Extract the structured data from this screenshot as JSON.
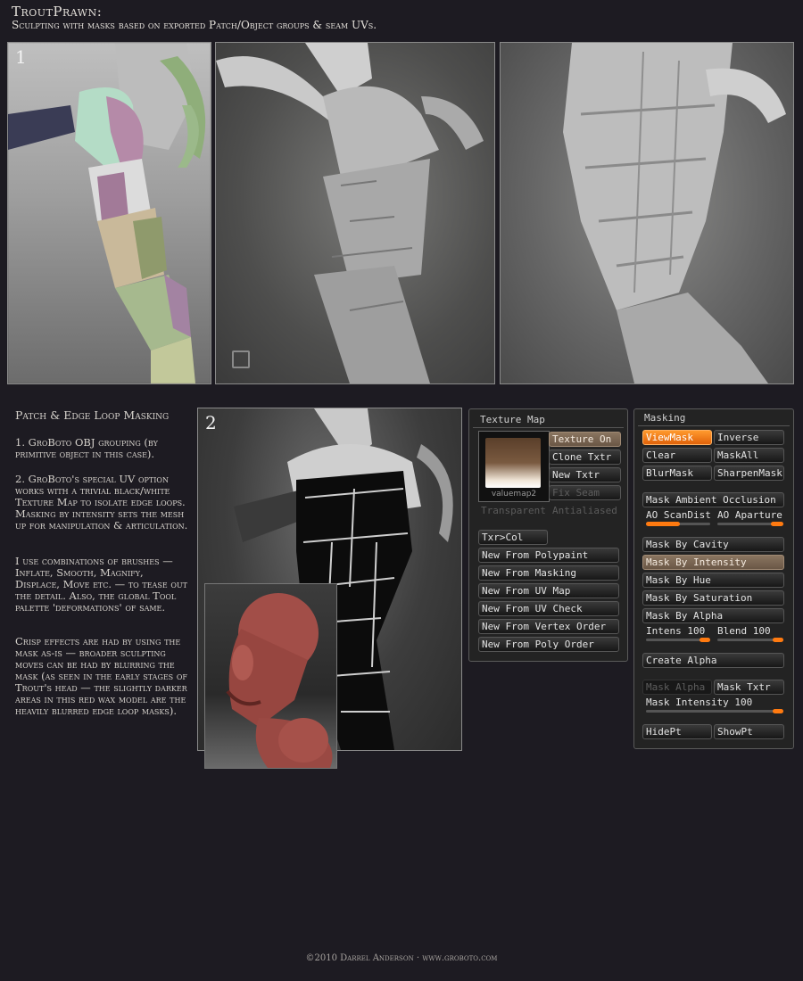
{
  "header": {
    "title": "TroutPrawn:",
    "subtitle": "Sculpting with masks based on exported Patch/Object groups & seam UVs."
  },
  "panels": {
    "top_number": "1",
    "bottom_number": "2"
  },
  "article": {
    "heading": "Patch & Edge Loop Masking",
    "p1": "1. GroBoto OBJ grouping (by primitive object in this case).",
    "p2": "2. GroBoto's special UV option works with a trivial black/white Texture Map to isolate edge loops. Masking by intensity sets the mesh up for manipulation & articulation.",
    "p3": "I use combinations of brushes — Inflate, Smooth, Magnify, Displace, Move etc. — to tease out the detail. Also, the global Tool palette 'deformations' of same.",
    "p4": "Crisp effects are had by using the mask as-is — broader sculpting moves can be had by blurring the mask (as seen in the early stages of Trout's head — the slightly darker areas in this red wax model are the heavily blurred edge loop masks)."
  },
  "texture_map": {
    "title": "Texture Map",
    "thumb_label": "valuemap2",
    "texture_on": "Texture On",
    "clone_txtr": "Clone Txtr",
    "new_txtr": "New Txtr",
    "fix_seam": "Fix Seam",
    "transparent": "Transparent",
    "antialiased": "Antialiased",
    "txr_col": "Txr>Col",
    "new_from_polypaint": "New From Polypaint",
    "new_from_masking": "New From Masking",
    "new_from_uv_map": "New From UV Map",
    "new_from_uv_check": "New From UV Check",
    "new_from_vertex_order": "New From Vertex Order",
    "new_from_poly_order": "New From Poly Order"
  },
  "masking": {
    "title": "Masking",
    "view_mask": "ViewMask",
    "inverse": "Inverse",
    "clear": "Clear",
    "mask_all": "MaskAll",
    "blur_mask": "BlurMask",
    "sharpen_mask": "SharpenMask",
    "mask_ambient_occlusion": "Mask Ambient Occlusion",
    "ao_scandist": "AO ScanDist",
    "ao_aparture": "AO Aparture",
    "mask_by_cavity": "Mask By Cavity",
    "mask_by_intensity": "Mask By Intensity",
    "mask_by_hue": "Mask By Hue",
    "mask_by_saturation": "Mask By Saturation",
    "mask_by_alpha": "Mask By Alpha",
    "intens_label": "Intens 100",
    "intens_value": 100,
    "blend_label": "Blend 100",
    "blend_value": 100,
    "create_alpha": "Create Alpha",
    "mask_alpha": "Mask Alpha",
    "mask_txtr": "Mask Txtr",
    "mask_intensity_label": "Mask Intensity 100",
    "mask_intensity_value": 100,
    "hide_pt": "HidePt",
    "show_pt": "ShowPt"
  },
  "colors": {
    "accent_orange": "#ff7a10",
    "active_tan": "#7a6653",
    "background": "#1d1b22"
  },
  "footer": "©2010 Darrel Anderson · www.groboto.com"
}
